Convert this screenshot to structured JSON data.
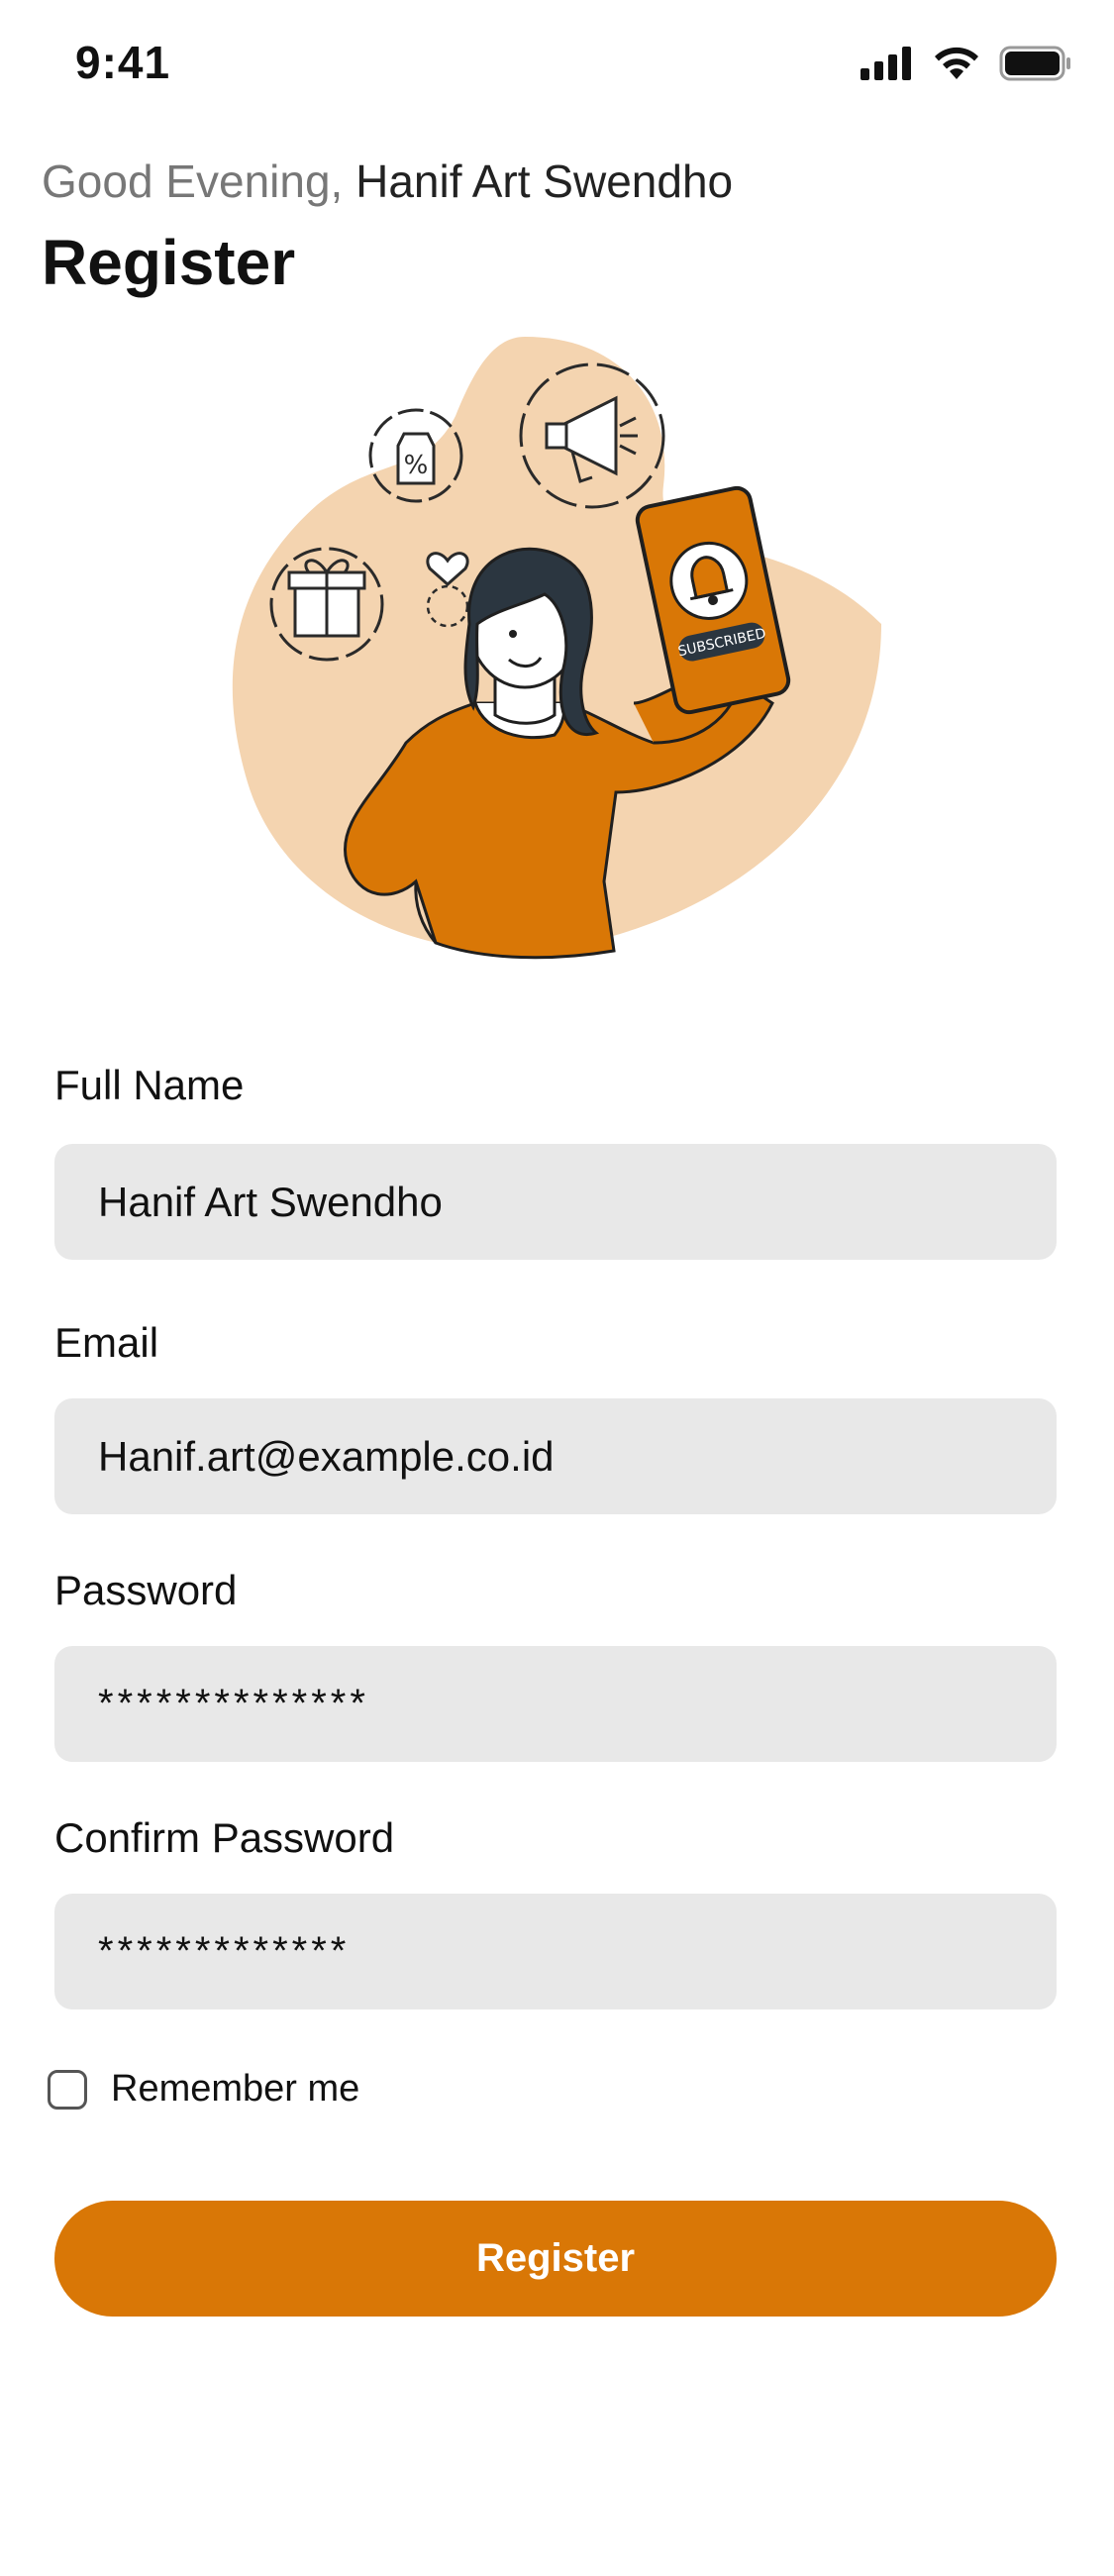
{
  "status_bar": {
    "time": "9:41"
  },
  "header": {
    "greeting_prefix": "Good Evening,",
    "user_name": "Hanif Art Swendho",
    "title": "Register"
  },
  "illustration": {
    "badge_text": "SUBSCRIBED",
    "icons": [
      "percent-tag-icon",
      "megaphone-icon",
      "gift-icon",
      "heart-icon",
      "bell-icon"
    ]
  },
  "form": {
    "full_name": {
      "label": "Full Name",
      "value": "Hanif Art Swendho"
    },
    "email": {
      "label": "Email",
      "value": "Hanif.art@example.co.id"
    },
    "password": {
      "label": "Password",
      "value": "**************"
    },
    "confirm_password": {
      "label": "Confirm Password",
      "value": "*************"
    },
    "remember_me": {
      "label": "Remember me",
      "checked": false
    },
    "submit_label": "Register"
  },
  "colors": {
    "accent": "#d97706",
    "blob": "#f4d4b0",
    "input_bg": "#e8e8e8",
    "muted_text": "#777777"
  }
}
